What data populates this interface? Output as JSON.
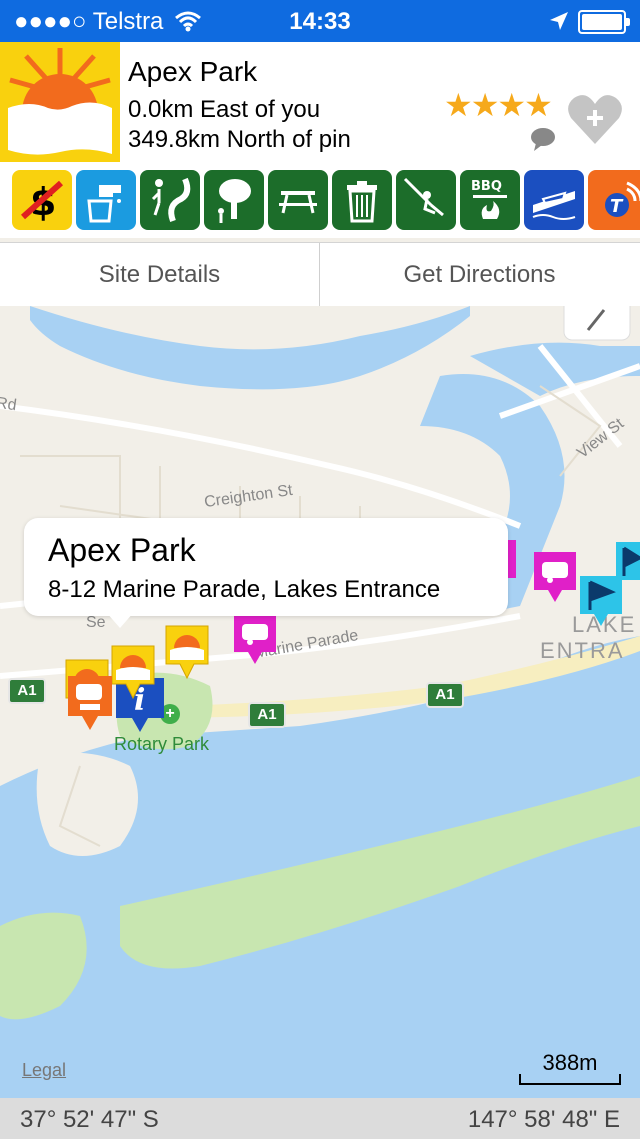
{
  "status_bar": {
    "carrier": "●●●●○ Telstra",
    "time": "14:33"
  },
  "site": {
    "name": "Apex Park",
    "distance_from_user": "0.0km East of you",
    "distance_from_pin": "349.8km North of pin",
    "rating_stars": 4,
    "rating_text": "★★★★"
  },
  "amenities": [
    {
      "icon": "no-fee-icon",
      "bg": "#f9d10e"
    },
    {
      "icon": "water-tap-icon",
      "bg": "#1b9be0"
    },
    {
      "icon": "walking-track-icon",
      "bg": "#1c6d2a"
    },
    {
      "icon": "shade-tree-icon",
      "bg": "#1c6d2a"
    },
    {
      "icon": "picnic-table-icon",
      "bg": "#1c6d2a"
    },
    {
      "icon": "rubbish-bin-icon",
      "bg": "#1c6d2a"
    },
    {
      "icon": "playground-swing-icon",
      "bg": "#1c6d2a"
    },
    {
      "icon": "bbq-icon",
      "bg": "#1c6d2a",
      "label": "BBQ"
    },
    {
      "icon": "boat-ramp-icon",
      "bg": "#1b4fc0"
    },
    {
      "icon": "telstra-signal-icon",
      "bg": "#f26b1d",
      "label": "T"
    }
  ],
  "tabs": {
    "details": "Site Details",
    "directions": "Get Directions"
  },
  "map": {
    "road_labels": [
      "Rd",
      "Creighton St",
      "View St",
      "Marine Parade",
      "Se"
    ],
    "road_shields": [
      "A1",
      "A1",
      "A1"
    ],
    "place_labels": [
      "Rotary Park",
      "LAKE",
      "ENTRA"
    ],
    "callout": {
      "title": "Apex Park",
      "address": "8-12 Marine Parade, Lakes Entrance"
    },
    "legal": "Legal",
    "scale": "388m"
  },
  "coordinates": {
    "latitude": "37° 52' 47\" S",
    "longitude": "147° 58' 48\" E"
  },
  "colors": {
    "status_bar": "#0f6be0",
    "water": "#a8d1f3",
    "land": "#f2efe8",
    "park": "#c8e6b0",
    "amenity_green": "#1c6d2a",
    "pin_magenta": "#e020c8",
    "pin_cyan": "#2dc4e8"
  }
}
